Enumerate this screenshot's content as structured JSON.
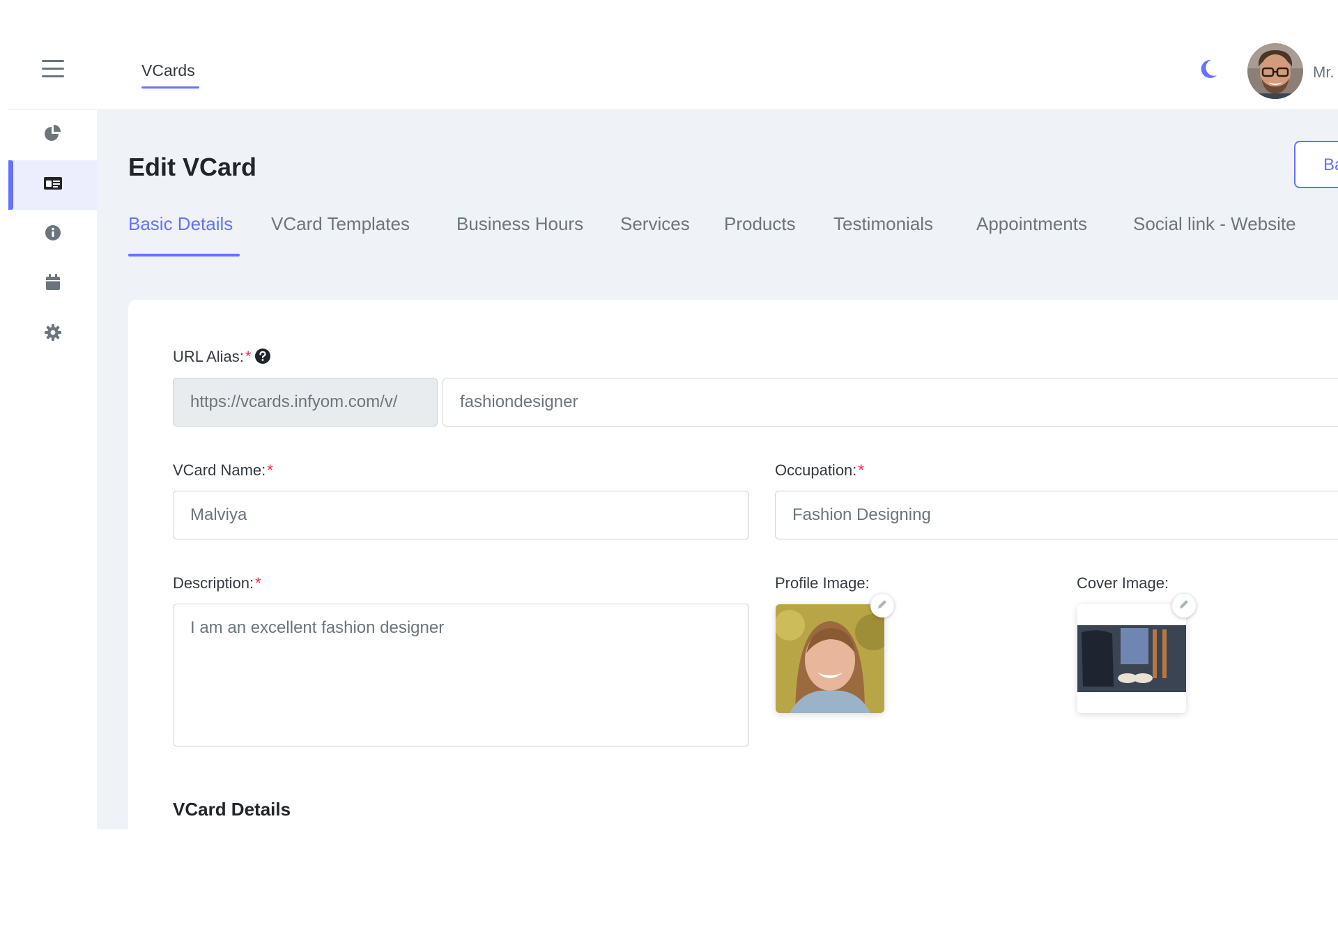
{
  "header": {
    "nav_tab": "VCards",
    "user_name": "Mr.",
    "icons": {
      "menu": "hamburger-icon",
      "theme": "moon-icon"
    }
  },
  "sidebar": {
    "items": [
      {
        "icon": "pie-chart-icon",
        "active": false
      },
      {
        "icon": "id-card-icon",
        "active": true
      },
      {
        "icon": "info-icon",
        "active": false
      },
      {
        "icon": "calendar-icon",
        "active": false
      },
      {
        "icon": "gear-icon",
        "active": false
      }
    ]
  },
  "page": {
    "title": "Edit VCard",
    "back_button": "Bac"
  },
  "tabs": [
    {
      "label": "Basic Details",
      "active": true
    },
    {
      "label": "VCard Templates",
      "active": false
    },
    {
      "label": "Business Hours",
      "active": false
    },
    {
      "label": "Services",
      "active": false
    },
    {
      "label": "Products",
      "active": false
    },
    {
      "label": "Testimonials",
      "active": false
    },
    {
      "label": "Appointments",
      "active": false
    },
    {
      "label": "Social link - Website",
      "active": false
    }
  ],
  "form": {
    "url_alias": {
      "label": "URL Alias:",
      "prefix": "https://vcards.infyom.com/v/",
      "value": "fashiondesigner"
    },
    "vcard_name": {
      "label": "VCard Name:",
      "value": "Malviya"
    },
    "occupation": {
      "label": "Occupation:",
      "value": "Fashion Designing"
    },
    "description": {
      "label": "Description:",
      "value": "I am an excellent fashion designer"
    },
    "profile_image": {
      "label": "Profile Image:"
    },
    "cover_image": {
      "label": "Cover Image:"
    },
    "required_mark": "*",
    "section_title": "VCard Details"
  },
  "colors": {
    "accent": "#6571ff",
    "required": "#f62947",
    "content_bg": "#eff3f7",
    "active_sidebar_bg": "#eceefe"
  }
}
